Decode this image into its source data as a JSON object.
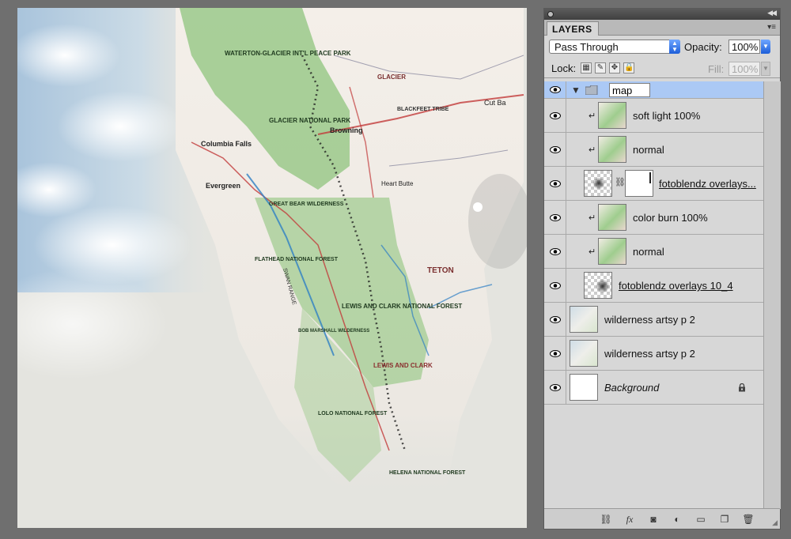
{
  "panel": {
    "tab_label": "LAYERS",
    "blend_mode": "Pass Through",
    "opacity_label": "Opacity:",
    "opacity_value": "100%",
    "lock_label": "Lock:",
    "fill_label": "Fill:",
    "fill_value": "100%"
  },
  "layers": [
    {
      "name": "map",
      "kind": "group",
      "selected": true
    },
    {
      "name": "soft light 100%",
      "kind": "clipped"
    },
    {
      "name": "normal",
      "kind": "clipped"
    },
    {
      "name": "fotoblendz overlays...",
      "kind": "masked"
    },
    {
      "name": "color burn 100%",
      "kind": "clipped"
    },
    {
      "name": "normal",
      "kind": "clipped"
    },
    {
      "name": "fotoblendz overlays 10_4",
      "kind": "linked"
    },
    {
      "name": "wilderness artsy p 2",
      "kind": "normal"
    },
    {
      "name": "wilderness artsy p 2",
      "kind": "normal"
    },
    {
      "name": "Background",
      "kind": "background",
      "locked": true
    }
  ],
  "map_labels": {
    "park1": "WATERTON-GLACIER INT'L PEACE PARK",
    "park2": "GLACIER NATIONAL PARK",
    "wilderness": "GREAT BEAR WILDERNESS",
    "flathead": "FLATHEAD NATIONAL FOREST",
    "lewis_clark": "LEWIS AND CLARK NATIONAL FOREST",
    "teton": "TETON",
    "bob_marshall": "BOB MARSHALL WILDERNESS",
    "lewis_clark2": "LEWIS AND CLARK",
    "lolo": "LOLO NATIONAL FOREST",
    "helena": "HELENA NATIONAL FOREST",
    "swan": "SWAN RANGE",
    "browning": "Browning",
    "columbia": "Columbia Falls",
    "evergreen": "Evergreen",
    "heart_butte": "Heart Butte",
    "glacier": "GLACIER",
    "blackfeet": "BLACKFEET TRIBE",
    "cut_bank": "Cut Ba"
  },
  "colors": {
    "panel_bg": "#d7d7d7",
    "selected_row": "#abc9f5",
    "map_green": "#7fb873",
    "sky": "#b9cfe0"
  }
}
